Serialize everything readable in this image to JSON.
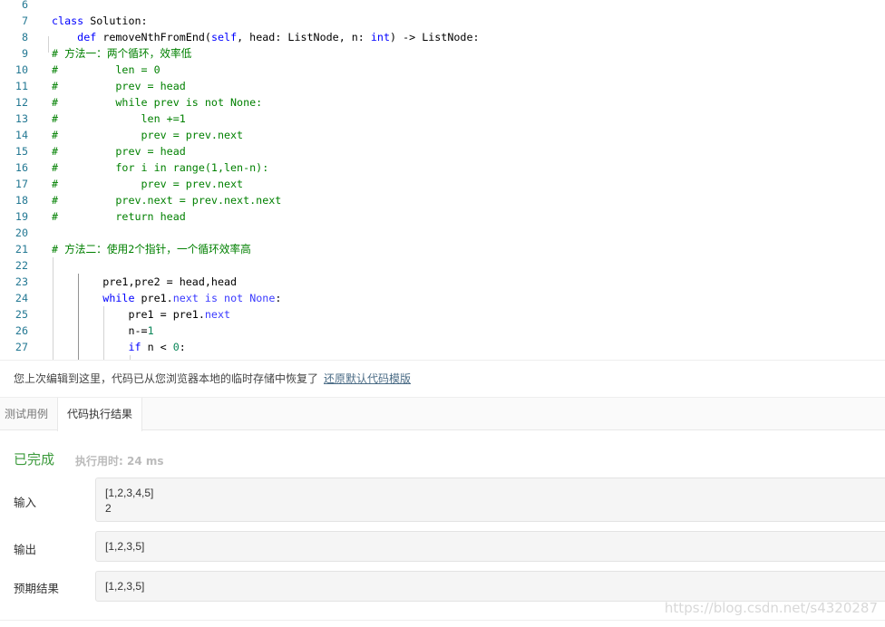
{
  "editor": {
    "colors": {
      "keyword": "#0000ff",
      "comment": "#008000",
      "number": "#098658",
      "line_number": "#237893"
    },
    "lines": [
      {
        "n": "6",
        "tokens": []
      },
      {
        "n": "7",
        "tokens": [
          [
            "kw",
            "class"
          ],
          [
            "plain",
            " Solution:"
          ]
        ]
      },
      {
        "n": "8",
        "tokens": [
          [
            "plain",
            "    "
          ],
          [
            "kw",
            "def"
          ],
          [
            "plain",
            " removeNthFromEnd("
          ],
          [
            "kw",
            "self"
          ],
          [
            "plain",
            ", head: ListNode, n: "
          ],
          [
            "kw",
            "int"
          ],
          [
            "plain",
            ") -> ListNode:"
          ]
        ]
      },
      {
        "n": "9",
        "tokens": [
          [
            "cm",
            "# 方法一：两个循环，效率低"
          ]
        ]
      },
      {
        "n": "10",
        "tokens": [
          [
            "cm",
            "#         len = 0"
          ]
        ]
      },
      {
        "n": "11",
        "tokens": [
          [
            "cm",
            "#         prev = head"
          ]
        ]
      },
      {
        "n": "12",
        "tokens": [
          [
            "cm",
            "#         while prev is not None:"
          ]
        ]
      },
      {
        "n": "13",
        "tokens": [
          [
            "cm",
            "#             len +=1"
          ]
        ]
      },
      {
        "n": "14",
        "tokens": [
          [
            "cm",
            "#             prev = prev.next"
          ]
        ]
      },
      {
        "n": "15",
        "tokens": [
          [
            "cm",
            "#         prev = head"
          ]
        ]
      },
      {
        "n": "16",
        "tokens": [
          [
            "cm",
            "#         for i in range(1,len-n):"
          ]
        ]
      },
      {
        "n": "17",
        "tokens": [
          [
            "cm",
            "#             prev = prev.next"
          ]
        ]
      },
      {
        "n": "18",
        "tokens": [
          [
            "cm",
            "#         prev.next = prev.next.next"
          ]
        ]
      },
      {
        "n": "19",
        "tokens": [
          [
            "cm",
            "#         return head"
          ]
        ]
      },
      {
        "n": "20",
        "tokens": []
      },
      {
        "n": "21",
        "tokens": [
          [
            "cm",
            "# 方法二：使用2个指针，一个循环效率高"
          ]
        ]
      },
      {
        "n": "22",
        "tokens": []
      },
      {
        "n": "23",
        "tokens": [
          [
            "plain",
            "        pre1,pre2 = head,head"
          ]
        ]
      },
      {
        "n": "24",
        "tokens": [
          [
            "plain",
            "        "
          ],
          [
            "kw",
            "while"
          ],
          [
            "plain",
            " pre1."
          ],
          [
            "prop",
            "next"
          ],
          [
            "plain",
            " "
          ],
          [
            "prop",
            "is"
          ],
          [
            "plain",
            " "
          ],
          [
            "prop",
            "not"
          ],
          [
            "plain",
            " "
          ],
          [
            "prop",
            "None"
          ],
          [
            "plain",
            ":"
          ]
        ]
      },
      {
        "n": "25",
        "tokens": [
          [
            "plain",
            "            pre1 = pre1."
          ],
          [
            "prop",
            "next"
          ]
        ]
      },
      {
        "n": "26",
        "tokens": [
          [
            "plain",
            "            n-="
          ],
          [
            "num",
            "1"
          ]
        ]
      },
      {
        "n": "27",
        "tokens": [
          [
            "plain",
            "            "
          ],
          [
            "kw",
            "if"
          ],
          [
            "plain",
            " n < "
          ],
          [
            "num",
            "0"
          ],
          [
            "plain",
            ":"
          ]
        ]
      }
    ]
  },
  "notice": {
    "message": "您上次编辑到这里，代码已从您浏览器本地的临时存储中恢复了",
    "restore_link": "还原默认代码模版"
  },
  "tabs": [
    {
      "label": "测试用例",
      "active": false
    },
    {
      "label": "代码执行结果",
      "active": true
    }
  ],
  "result": {
    "status": "已完成",
    "status_color": "#3b9a3b",
    "runtime": "执行用时: 24 ms",
    "input_label": "输入",
    "input_value": "[1,2,3,4,5]\n2",
    "output_label": "输出",
    "output_value": "[1,2,3,5]",
    "expected_label": "预期结果",
    "expected_value": "[1,2,3,5]"
  },
  "watermark": "https://blog.csdn.net/s4320287"
}
